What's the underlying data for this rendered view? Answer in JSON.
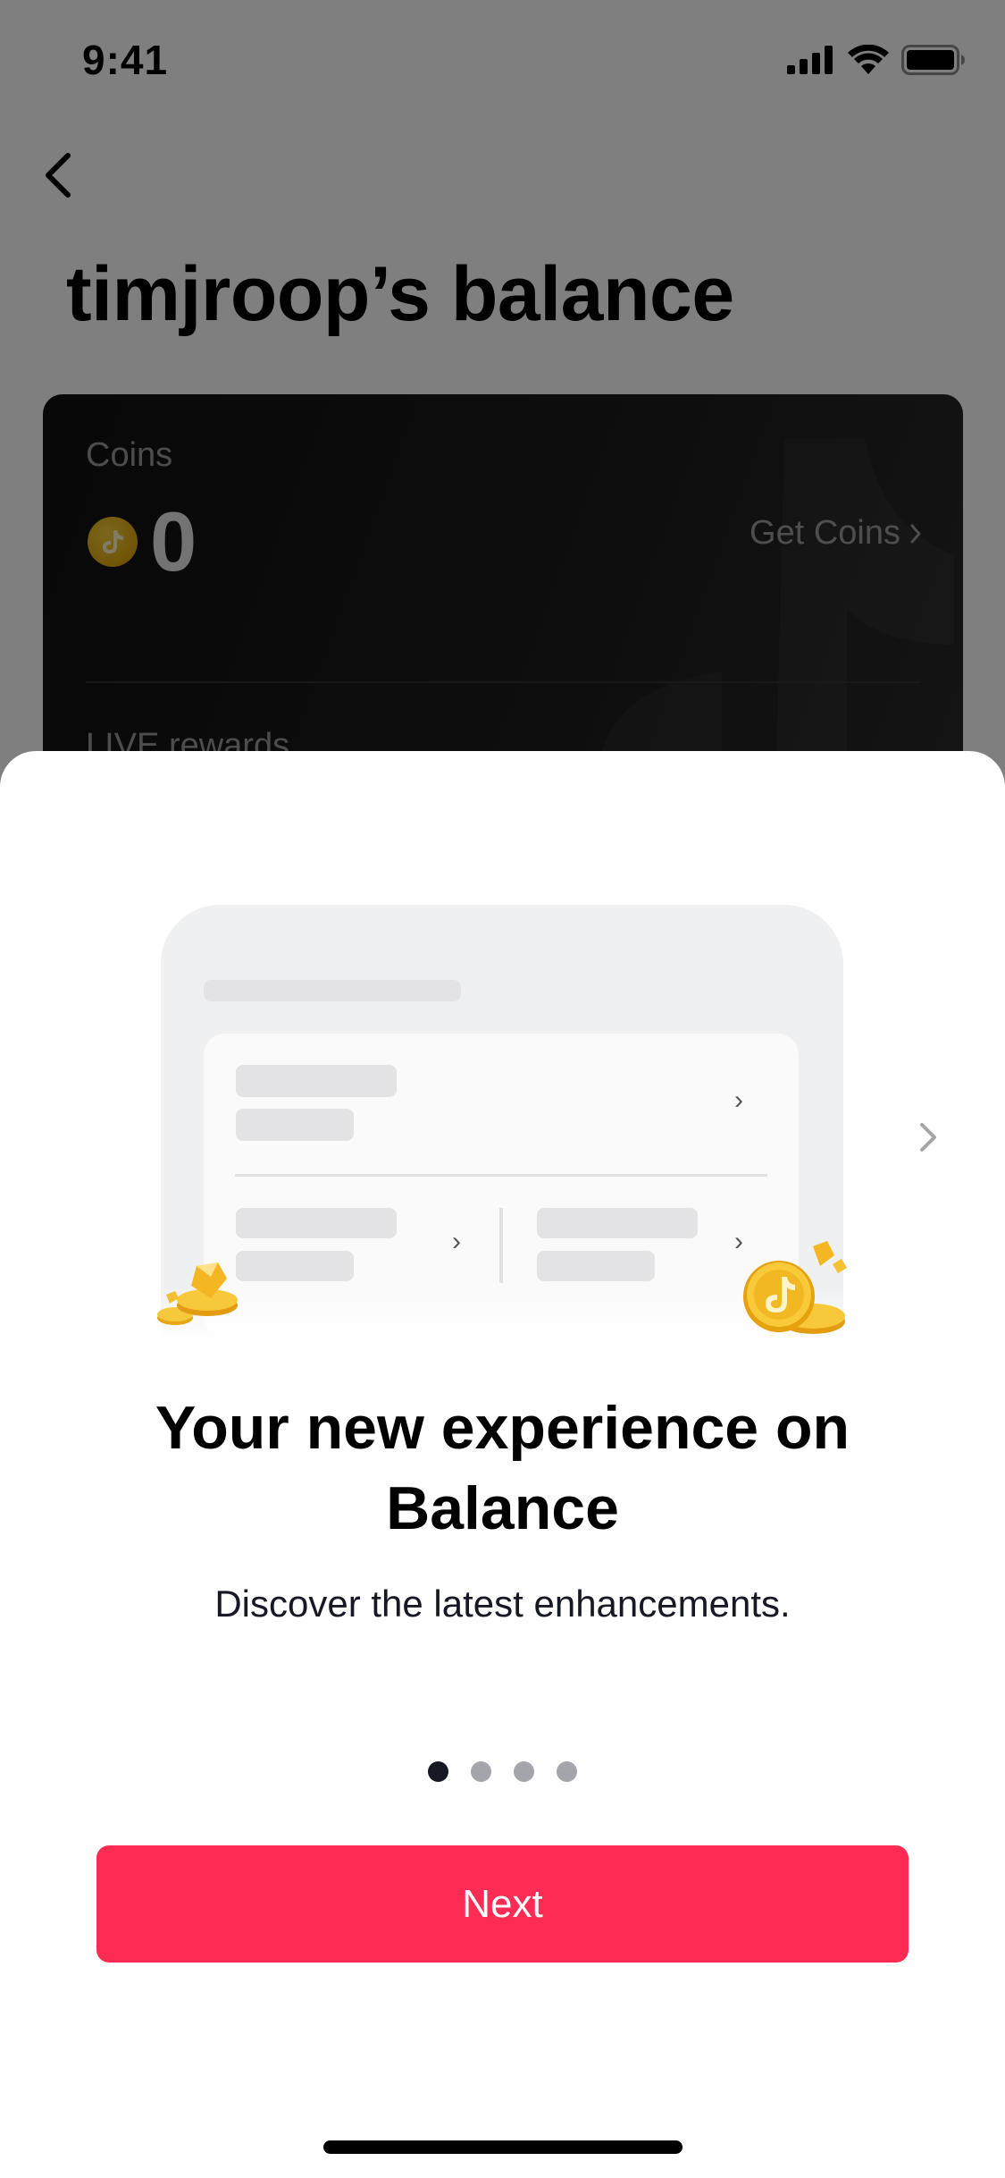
{
  "status_bar": {
    "time": "9:41"
  },
  "page": {
    "title": "timjroop’s balance",
    "card": {
      "coins_label": "Coins",
      "coins_value": "0",
      "get_coins_label": "Get Coins",
      "live_rewards_label": "LIVE rewards"
    }
  },
  "sheet": {
    "title_line1": "Your new experience on",
    "title_line2": "Balance",
    "subtitle": "Discover the latest enhancements.",
    "pager": {
      "total": 4,
      "active_index": 0
    },
    "next_button_label": "Next"
  },
  "icons": {
    "back": "chevron-left-icon",
    "get_coins": "chevron-right-icon",
    "next_slide": "chevron-right-icon",
    "signal": "signal-bars-icon",
    "wifi": "wifi-icon",
    "battery": "battery-icon",
    "coin": "tiktok-coin-icon"
  },
  "colors": {
    "accent": "#fe2c55",
    "pager_active": "#161823",
    "pager_inactive": "#a4a5ab",
    "coin_gold": "#e2a810"
  }
}
